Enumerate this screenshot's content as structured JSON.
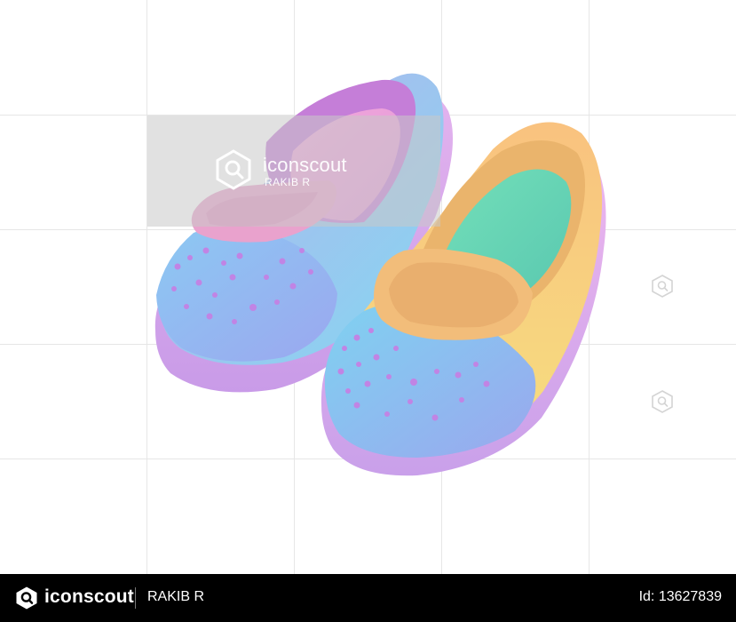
{
  "watermark": {
    "brand": "iconscout",
    "author": "RAKIB R",
    "logo_icon": "iconscout-logo-icon"
  },
  "footer": {
    "brand": "iconscout",
    "author": "RAKIB R",
    "asset_id": "Id: 13627839",
    "logo_icon": "iconscout-logo-icon",
    "background": "#000000",
    "text_color": "#ffffff"
  },
  "illustration": {
    "subject": "pair-of-pastel-shoes",
    "colors": {
      "left_upper": "#9fb0ef",
      "left_tongue": "#e7a3d3",
      "left_sole": "#d6a6ee",
      "right_upper": "#f7cf7e",
      "right_insole": "#69d7b2",
      "right_toe": "#89b5f1",
      "right_tongue": "#efc285",
      "right_sole": "#d8b1ef",
      "dots": "#c485e6"
    }
  }
}
